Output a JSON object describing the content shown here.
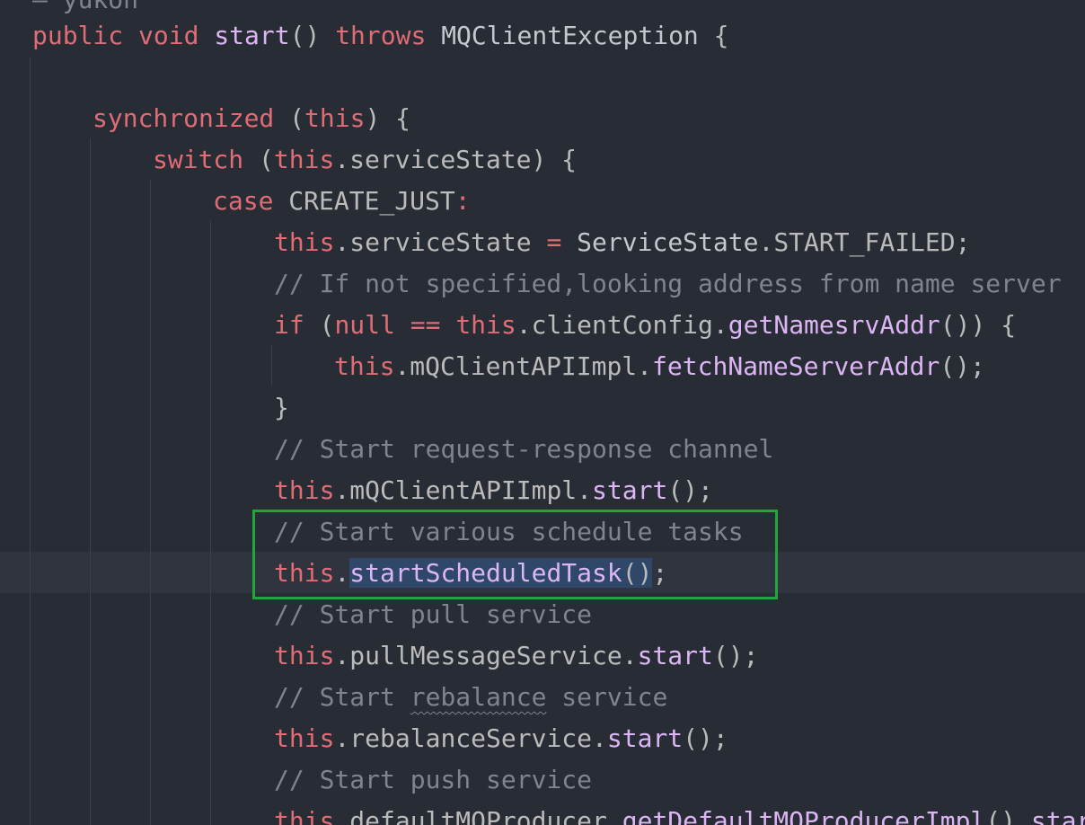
{
  "editor": {
    "accent_colors": {
      "keyword": "#e06c75",
      "method": "#dcb6f4",
      "comment": "#7f848e",
      "identifier": "#bbbbbb",
      "background": "#282c34",
      "highlight_box": "#22a63a",
      "selection": "#2f4869"
    },
    "lines": [
      {
        "tokens": [
          {
            "t": "cm",
            "v": "– yukon"
          }
        ]
      },
      {
        "tokens": [
          {
            "t": "kw",
            "v": "public"
          },
          {
            "t": "pu",
            "v": " "
          },
          {
            "t": "kw",
            "v": "void"
          },
          {
            "t": "pu",
            "v": " "
          },
          {
            "t": "fn",
            "v": "start"
          },
          {
            "t": "pu",
            "v": "() "
          },
          {
            "t": "kw",
            "v": "throws"
          },
          {
            "t": "pu",
            "v": " "
          },
          {
            "t": "ty",
            "v": "MQClientException"
          },
          {
            "t": "pu",
            "v": " {"
          }
        ]
      },
      {
        "tokens": []
      },
      {
        "tokens": [
          {
            "t": "kw",
            "v": "synchronized"
          },
          {
            "t": "pu",
            "v": " ("
          },
          {
            "t": "kw",
            "v": "this"
          },
          {
            "t": "pu",
            "v": ") {"
          }
        ]
      },
      {
        "tokens": [
          {
            "t": "kw",
            "v": "switch"
          },
          {
            "t": "pu",
            "v": " ("
          },
          {
            "t": "kw",
            "v": "this"
          },
          {
            "t": "pu",
            "v": "."
          },
          {
            "t": "id",
            "v": "serviceState"
          },
          {
            "t": "pu",
            "v": ") {"
          }
        ]
      },
      {
        "tokens": [
          {
            "t": "kw",
            "v": "case"
          },
          {
            "t": "pu",
            "v": " "
          },
          {
            "t": "id",
            "v": "CREATE_JUST"
          },
          {
            "t": "op",
            "v": ":"
          }
        ]
      },
      {
        "tokens": [
          {
            "t": "kw",
            "v": "this"
          },
          {
            "t": "pu",
            "v": "."
          },
          {
            "t": "id",
            "v": "serviceState"
          },
          {
            "t": "pu",
            "v": " "
          },
          {
            "t": "op",
            "v": "="
          },
          {
            "t": "pu",
            "v": " "
          },
          {
            "t": "ty",
            "v": "ServiceState"
          },
          {
            "t": "pu",
            "v": "."
          },
          {
            "t": "id",
            "v": "START_FAILED"
          },
          {
            "t": "pu",
            "v": ";"
          }
        ]
      },
      {
        "tokens": [
          {
            "t": "cm",
            "v": "// If not specified,looking address from name server"
          }
        ]
      },
      {
        "tokens": [
          {
            "t": "kw",
            "v": "if"
          },
          {
            "t": "pu",
            "v": " ("
          },
          {
            "t": "kw",
            "v": "null"
          },
          {
            "t": "pu",
            "v": " "
          },
          {
            "t": "op",
            "v": "=="
          },
          {
            "t": "pu",
            "v": " "
          },
          {
            "t": "kw",
            "v": "this"
          },
          {
            "t": "pu",
            "v": "."
          },
          {
            "t": "id",
            "v": "clientConfig"
          },
          {
            "t": "pu",
            "v": "."
          },
          {
            "t": "fn",
            "v": "getNamesrvAddr"
          },
          {
            "t": "pu",
            "v": "()) {"
          }
        ]
      },
      {
        "tokens": [
          {
            "t": "kw",
            "v": "this"
          },
          {
            "t": "pu",
            "v": "."
          },
          {
            "t": "id",
            "v": "mQClientAPIImpl"
          },
          {
            "t": "pu",
            "v": "."
          },
          {
            "t": "fn",
            "v": "fetchNameServerAddr"
          },
          {
            "t": "pu",
            "v": "();"
          }
        ]
      },
      {
        "tokens": [
          {
            "t": "pu",
            "v": "}"
          }
        ]
      },
      {
        "tokens": [
          {
            "t": "cm",
            "v": "// Start request-response channel"
          }
        ]
      },
      {
        "tokens": [
          {
            "t": "kw",
            "v": "this"
          },
          {
            "t": "pu",
            "v": "."
          },
          {
            "t": "id",
            "v": "mQClientAPIImpl"
          },
          {
            "t": "pu",
            "v": "."
          },
          {
            "t": "fn",
            "v": "start"
          },
          {
            "t": "pu",
            "v": "();"
          }
        ]
      },
      {
        "tokens": [
          {
            "t": "cm",
            "v": "// Start various schedule tasks"
          }
        ]
      },
      {
        "tokens": [
          {
            "t": "kw",
            "v": "this"
          },
          {
            "t": "pu",
            "v": "."
          },
          {
            "t": "fn sel",
            "v": "startScheduledTask"
          },
          {
            "t": "pu sel",
            "v": "()"
          },
          {
            "t": "pu",
            "v": ";"
          }
        ]
      },
      {
        "tokens": [
          {
            "t": "cm",
            "v": "// Start pull service"
          }
        ]
      },
      {
        "tokens": [
          {
            "t": "kw",
            "v": "this"
          },
          {
            "t": "pu",
            "v": "."
          },
          {
            "t": "id",
            "v": "pullMessageService"
          },
          {
            "t": "pu",
            "v": "."
          },
          {
            "t": "fn",
            "v": "start"
          },
          {
            "t": "pu",
            "v": "();"
          }
        ]
      },
      {
        "tokens": [
          {
            "t": "cm",
            "v": "// Start "
          },
          {
            "t": "cm tagged",
            "v": "rebalance"
          },
          {
            "t": "cm",
            "v": " service"
          }
        ]
      },
      {
        "tokens": [
          {
            "t": "kw",
            "v": "this"
          },
          {
            "t": "pu",
            "v": "."
          },
          {
            "t": "id",
            "v": "rebalanceService"
          },
          {
            "t": "pu",
            "v": "."
          },
          {
            "t": "fn",
            "v": "start"
          },
          {
            "t": "pu",
            "v": "();"
          }
        ]
      },
      {
        "tokens": [
          {
            "t": "cm",
            "v": "// Start push service"
          }
        ]
      },
      {
        "tokens": [
          {
            "t": "kw",
            "v": "this"
          },
          {
            "t": "pu",
            "v": "."
          },
          {
            "t": "id",
            "v": "defaultMQProducer"
          },
          {
            "t": "pu",
            "v": "."
          },
          {
            "t": "fn",
            "v": "getDefaultMQProducerImpl"
          },
          {
            "t": "pu",
            "v": "()."
          },
          {
            "t": "fn",
            "v": "start"
          }
        ]
      }
    ]
  }
}
